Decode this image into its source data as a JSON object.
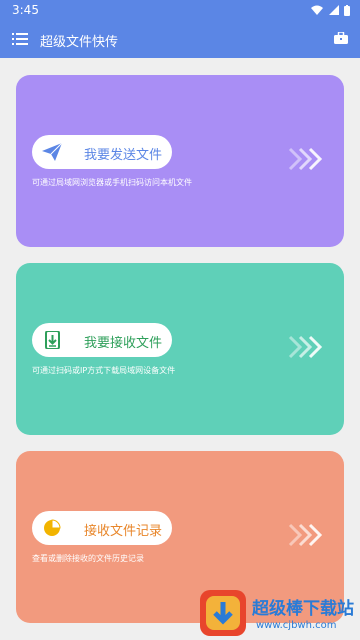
{
  "status": {
    "time": "3:45"
  },
  "appbar": {
    "title": "超级文件快传"
  },
  "cards": [
    {
      "label": "我要发送文件",
      "desc": "可通过局域网浏览器或手机扫码访问本机文件",
      "color": "#a98ef5",
      "icon": "paper-plane-icon"
    },
    {
      "label": "我要接收文件",
      "desc": "可通过扫码或IP方式下载局域网设备文件",
      "color": "#5fd0b8",
      "icon": "download-file-icon"
    },
    {
      "label": "接收文件记录",
      "desc": "查看或删除接收的文件历史记录",
      "color": "#f29a7e",
      "icon": "pie-chart-icon"
    }
  ],
  "watermark": {
    "title": "超级棒下载站",
    "url": "www.cjbwh.com"
  }
}
